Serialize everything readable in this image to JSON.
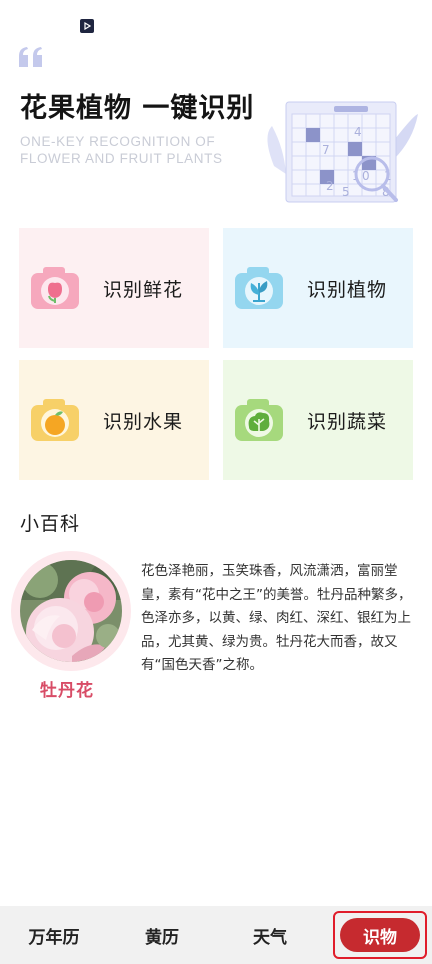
{
  "hero": {
    "title": "花果植物 一键识别",
    "subtitle_line1": "ONE-KEY RECOGNITION OF",
    "subtitle_line2": "FLOWER AND FRUIT PLANTS"
  },
  "cards": [
    {
      "label": "识别鲜花",
      "icon": "flower-camera-icon",
      "color": "#f49ab2"
    },
    {
      "label": "识别植物",
      "icon": "plant-camera-icon",
      "color": "#8fd3ef"
    },
    {
      "label": "识别水果",
      "icon": "fruit-camera-icon",
      "color": "#f7cf63"
    },
    {
      "label": "识别蔬菜",
      "icon": "vegetable-camera-icon",
      "color": "#a3d97a"
    }
  ],
  "encyclopedia": {
    "title": "小百科",
    "flower_name": "牡丹花",
    "description": "花色泽艳丽，玉笑珠香，风流潇洒，富丽堂皇，素有“花中之王”的美誉。牡丹品种繁多，色泽亦多，以黄、绿、肉红、深红、银红为上品，尤其黄、绿为贵。牡丹花大而香，故又有“国色天香”之称。"
  },
  "tabbar": {
    "tabs": [
      {
        "label": "万年历"
      },
      {
        "label": "黄历"
      },
      {
        "label": "天气"
      },
      {
        "label": "识物"
      }
    ],
    "active_index": 3,
    "active_color": "#c62a2f",
    "highlight_color": "#e01d2b"
  }
}
